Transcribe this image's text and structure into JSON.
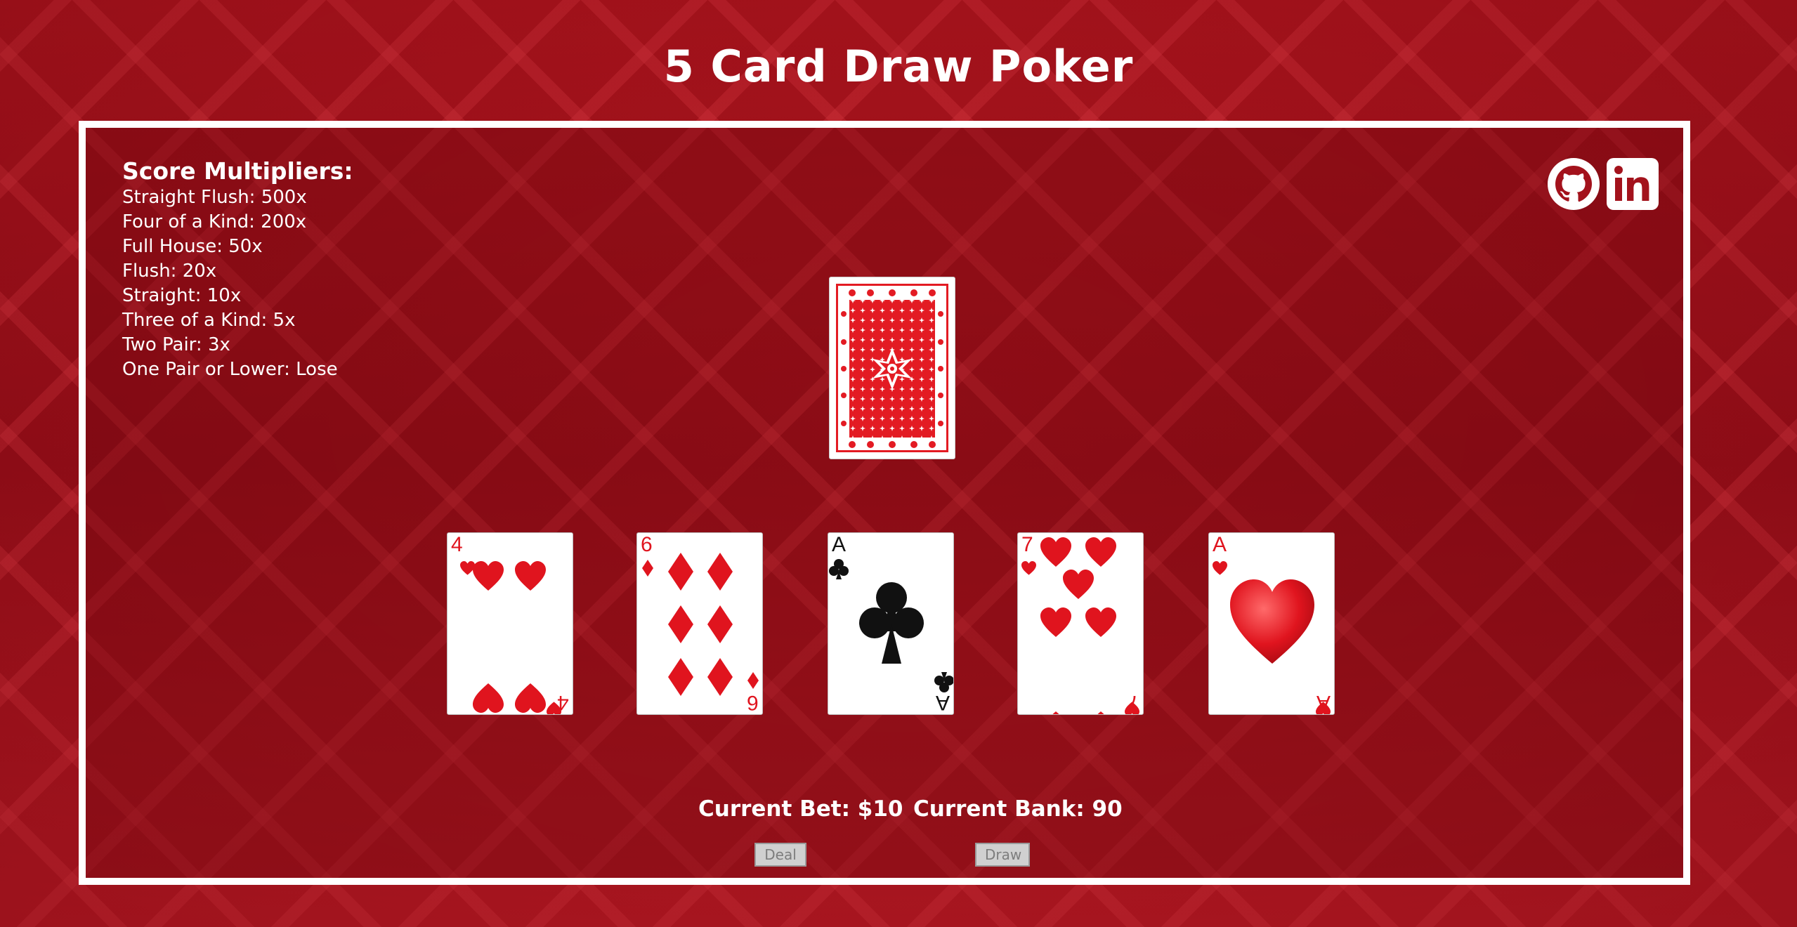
{
  "page": {
    "title": "5 Card Draw Poker"
  },
  "multipliers": {
    "heading": "Score Multipliers:",
    "items": [
      "Straight Flush: 500x",
      "Four of a Kind: 200x",
      "Full House: 50x",
      "Flush: 20x",
      "Straight: 10x",
      "Three of a Kind: 5x",
      "Two Pair: 3x",
      "One Pair or Lower: Lose"
    ]
  },
  "social": {
    "github_icon": "github-icon",
    "linkedin_icon": "linkedin-icon"
  },
  "hand": [
    {
      "rank": "4",
      "suit": "hearts",
      "color": "red"
    },
    {
      "rank": "6",
      "suit": "diamonds",
      "color": "red"
    },
    {
      "rank": "A",
      "suit": "clubs",
      "color": "black"
    },
    {
      "rank": "7",
      "suit": "hearts",
      "color": "red"
    },
    {
      "rank": "A",
      "suit": "hearts",
      "color": "red"
    }
  ],
  "status": {
    "bet": "Current Bet: $10",
    "bank": "Current Bank: 90"
  },
  "buttons": {
    "deal": "Deal",
    "draw": "Draw"
  },
  "colors": {
    "card_red": "#e0141e",
    "card_black": "#111111",
    "felt_red": "#a8141f",
    "border_white": "#ffffff"
  }
}
